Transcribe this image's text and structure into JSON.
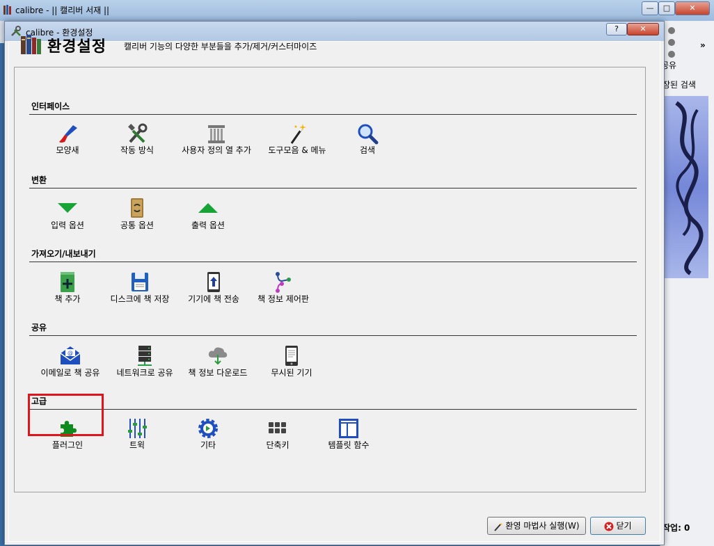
{
  "main_window": {
    "title": "calibre - || 캘리버 서재 ||",
    "minimize": "—",
    "maximize": "□",
    "close": "✕",
    "right_panel": {
      "share_label": "공유",
      "saved_search_label": "장된 검색",
      "more": "»",
      "jobs_label": "작업: 0"
    }
  },
  "dialog": {
    "title": "calibre - 환경설정",
    "help_button": "?",
    "close_button": "✕",
    "header_title": "환경설정",
    "header_subtitle": "캘리버 기능의 다양한 부분들을 추가/제거/커스터마이즈",
    "sections": [
      {
        "label": "인터페이스",
        "items": [
          {
            "label": "모양새",
            "icon": "paintbrush-icon"
          },
          {
            "label": "작동 방식",
            "icon": "tools-icon"
          },
          {
            "label": "사용자 정의 열 추가",
            "icon": "column-icon"
          },
          {
            "label": "도구모음 & 메뉴",
            "icon": "magic-wand-icon"
          },
          {
            "label": "검색",
            "icon": "search-icon"
          }
        ]
      },
      {
        "label": "변환",
        "items": [
          {
            "label": "입력 옵션",
            "icon": "arrow-down-icon"
          },
          {
            "label": "공통 옵션",
            "icon": "convert-book-icon"
          },
          {
            "label": "출력 옵션",
            "icon": "arrow-up-icon"
          }
        ]
      },
      {
        "label": "가져오기/내보내기",
        "items": [
          {
            "label": "책 추가",
            "icon": "add-book-icon"
          },
          {
            "label": "디스크에 책 저장",
            "icon": "floppy-disk-icon"
          },
          {
            "label": "기기에 책 전송",
            "icon": "device-send-icon"
          },
          {
            "label": "책 정보 제어판",
            "icon": "plugboard-icon"
          }
        ]
      },
      {
        "label": "공유",
        "items": [
          {
            "label": "이메일로 책 공유",
            "icon": "email-icon"
          },
          {
            "label": "네트워크로 공유",
            "icon": "network-server-icon"
          },
          {
            "label": "책 정보 다운로드",
            "icon": "cloud-download-icon"
          },
          {
            "label": "무시된 기기",
            "icon": "ebook-reader-icon"
          }
        ]
      },
      {
        "label": "고급",
        "items": [
          {
            "label": "플러그인",
            "icon": "puzzle-piece-icon"
          },
          {
            "label": "트윅",
            "icon": "sliders-icon"
          },
          {
            "label": "기타",
            "icon": "gear-icon"
          },
          {
            "label": "단축키",
            "icon": "keyboard-icon"
          },
          {
            "label": "템플릿 함수",
            "icon": "template-icon"
          }
        ]
      }
    ],
    "footer": {
      "wizard_button": "환영 마법사 실행(W)",
      "close_button": "닫기"
    }
  },
  "colors": {
    "highlight": "#e0141c",
    "accent_blue": "#1f5fbf",
    "green": "#1b9a2a"
  }
}
